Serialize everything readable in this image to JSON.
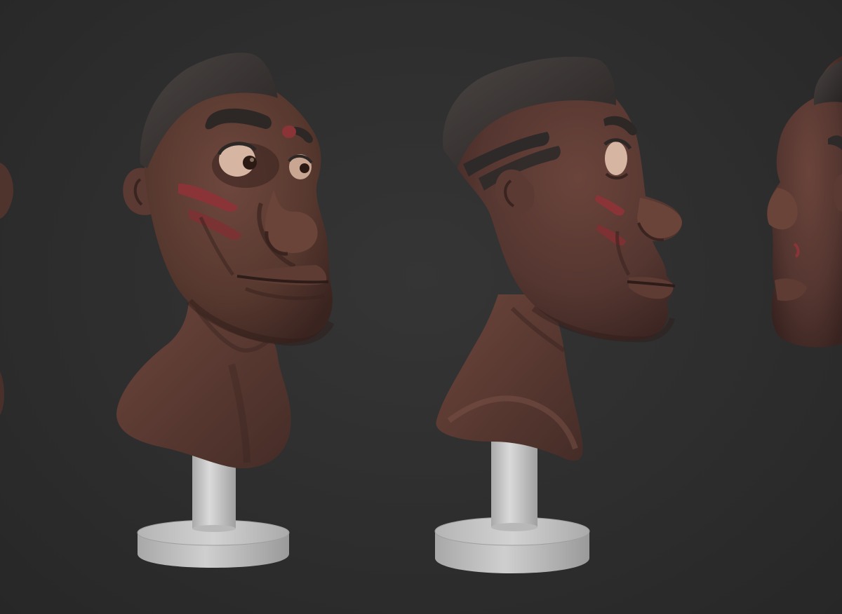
{
  "viewport": {
    "background": "#2f2f2f",
    "subject": "sculpted-head-bust-turnaround"
  },
  "colors": {
    "skin": "#5a3a33",
    "skin_shadow": "#3d2622",
    "skin_highlight": "#7a5248",
    "hair": "#2e2a29",
    "hair_highlight": "#4a4543",
    "face_paint": "#8a3437",
    "pedestal": "#c4c4c4",
    "pedestal_shadow": "#9b9b9b",
    "eye_white": "#d8b9a6",
    "iris": "#2b1a14"
  },
  "views": [
    {
      "name": "bust-left-edge-partial"
    },
    {
      "name": "bust-three-quarter"
    },
    {
      "name": "bust-profile"
    },
    {
      "name": "bust-right-edge-partial"
    }
  ]
}
